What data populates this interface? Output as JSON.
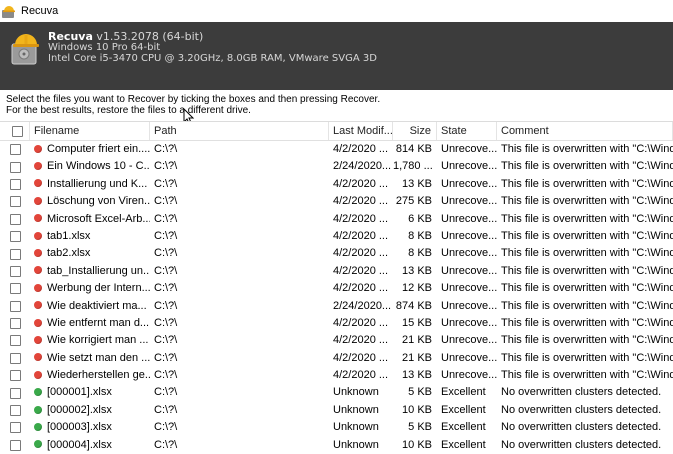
{
  "window": {
    "title": "Recuva"
  },
  "header": {
    "product_name": "Recuva",
    "version": "v1.53.2078 (64-bit)",
    "os": "Windows 10 Pro 64-bit",
    "hardware": "Intel Core i5-3470 CPU @ 3.20GHz, 8.0GB RAM, VMware SVGA 3D"
  },
  "instructions": {
    "line1": "Select the files you want to Recover by ticking the boxes and then pressing Recover.",
    "line2": "For the best results, restore the files to a different drive."
  },
  "columns": {
    "filename": "Filename",
    "path": "Path",
    "last_modified": "Last Modif...",
    "size": "Size",
    "state": "State",
    "comment": "Comment"
  },
  "colors": {
    "red_status": "#e2453a",
    "green_status": "#3aa94a",
    "header_bg": "#3c3c3c"
  },
  "rows": [
    {
      "status": "red",
      "filename": "Computer friert ein....",
      "path": "C:\\?\\",
      "date": "4/2/2020 ...",
      "size": "814 KB",
      "state": "Unrecove...",
      "comment": "This file is overwritten with \"C:\\Windo"
    },
    {
      "status": "red",
      "filename": "Ein Windows 10 - C...",
      "path": "C:\\?\\",
      "date": "2/24/2020...",
      "size": "1,780 ...",
      "state": "Unrecove...",
      "comment": "This file is overwritten with \"C:\\Windo"
    },
    {
      "status": "red",
      "filename": "Installierung und K...",
      "path": "C:\\?\\",
      "date": "4/2/2020 ...",
      "size": "13 KB",
      "state": "Unrecove...",
      "comment": "This file is overwritten with \"C:\\Windo"
    },
    {
      "status": "red",
      "filename": "Löschung von Viren...",
      "path": "C:\\?\\",
      "date": "4/2/2020 ...",
      "size": "275 KB",
      "state": "Unrecove...",
      "comment": "This file is overwritten with \"C:\\Windo"
    },
    {
      "status": "red",
      "filename": "Microsoft Excel-Arb...",
      "path": "C:\\?\\",
      "date": "4/2/2020 ...",
      "size": "6 KB",
      "state": "Unrecove...",
      "comment": "This file is overwritten with \"C:\\Windo"
    },
    {
      "status": "red",
      "filename": "tab1.xlsx",
      "path": "C:\\?\\",
      "date": "4/2/2020 ...",
      "size": "8 KB",
      "state": "Unrecove...",
      "comment": "This file is overwritten with \"C:\\Windo"
    },
    {
      "status": "red",
      "filename": "tab2.xlsx",
      "path": "C:\\?\\",
      "date": "4/2/2020 ...",
      "size": "8 KB",
      "state": "Unrecove...",
      "comment": "This file is overwritten with \"C:\\Windo"
    },
    {
      "status": "red",
      "filename": "tab_Installierung un...",
      "path": "C:\\?\\",
      "date": "4/2/2020 ...",
      "size": "13 KB",
      "state": "Unrecove...",
      "comment": "This file is overwritten with \"C:\\Windo"
    },
    {
      "status": "red",
      "filename": "Werbung der Intern...",
      "path": "C:\\?\\",
      "date": "4/2/2020 ...",
      "size": "12 KB",
      "state": "Unrecove...",
      "comment": "This file is overwritten with \"C:\\Windo"
    },
    {
      "status": "red",
      "filename": "Wie deaktiviert ma...",
      "path": "C:\\?\\",
      "date": "2/24/2020...",
      "size": "874 KB",
      "state": "Unrecove...",
      "comment": "This file is overwritten with \"C:\\Windo"
    },
    {
      "status": "red",
      "filename": "Wie entfernt man d...",
      "path": "C:\\?\\",
      "date": "4/2/2020 ...",
      "size": "15 KB",
      "state": "Unrecove...",
      "comment": "This file is overwritten with \"C:\\Windo"
    },
    {
      "status": "red",
      "filename": "Wie korrigiert man ...",
      "path": "C:\\?\\",
      "date": "4/2/2020 ...",
      "size": "21 KB",
      "state": "Unrecove...",
      "comment": "This file is overwritten with \"C:\\Windo"
    },
    {
      "status": "red",
      "filename": "Wie setzt man den ...",
      "path": "C:\\?\\",
      "date": "4/2/2020 ...",
      "size": "21 KB",
      "state": "Unrecove...",
      "comment": "This file is overwritten with \"C:\\Windo"
    },
    {
      "status": "red",
      "filename": "Wiederherstellen ge...",
      "path": "C:\\?\\",
      "date": "4/2/2020 ...",
      "size": "13 KB",
      "state": "Unrecove...",
      "comment": "This file is overwritten with \"C:\\Windo"
    },
    {
      "status": "green",
      "filename": "[000001].xlsx",
      "path": "C:\\?\\",
      "date": "Unknown",
      "size": "5 KB",
      "state": "Excellent",
      "comment": "No overwritten clusters detected."
    },
    {
      "status": "green",
      "filename": "[000002].xlsx",
      "path": "C:\\?\\",
      "date": "Unknown",
      "size": "10 KB",
      "state": "Excellent",
      "comment": "No overwritten clusters detected."
    },
    {
      "status": "green",
      "filename": "[000003].xlsx",
      "path": "C:\\?\\",
      "date": "Unknown",
      "size": "5 KB",
      "state": "Excellent",
      "comment": "No overwritten clusters detected."
    },
    {
      "status": "green",
      "filename": "[000004].xlsx",
      "path": "C:\\?\\",
      "date": "Unknown",
      "size": "10 KB",
      "state": "Excellent",
      "comment": "No overwritten clusters detected."
    }
  ]
}
